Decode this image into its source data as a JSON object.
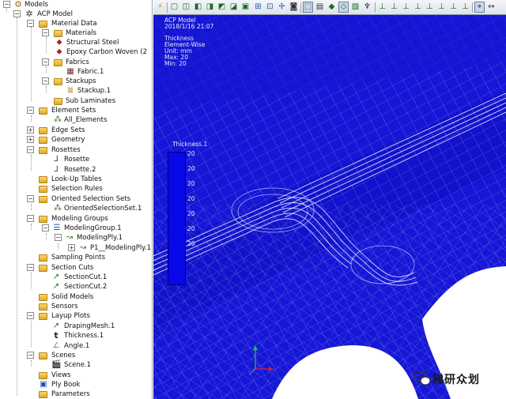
{
  "tree": {
    "root": "Models",
    "model": "ACP Model",
    "material_data": "Material Data",
    "materials": "Materials",
    "material_1": "Structural Steel",
    "material_2": "Epoxy Carbon Woven (2",
    "fabrics": "Fabrics",
    "fabric_1": "Fabric.1",
    "stackups": "Stackups",
    "stackup_1": "Stackup.1",
    "sub_laminates": "Sub Laminates",
    "element_sets": "Element Sets",
    "all_elements": "All_Elements",
    "edge_sets": "Edge Sets",
    "geometry": "Geometry",
    "rosettes": "Rosettes",
    "rosette_1": "Rosette",
    "rosette_2": "Rosette.2",
    "lookup_tables": "Look-Up Tables",
    "selection_rules": "Selection Rules",
    "oriented_selection_sets": "Oriented Selection Sets",
    "oss_1": "OrientedSelectionSet.1",
    "modeling_groups": "Modeling Groups",
    "modeling_group_1": "ModelingGroup.1",
    "modeling_ply_1": "ModelingPly.1",
    "production_ply": "P1__ModelingPly.1",
    "sampling_points": "Sampling Points",
    "section_cuts": "Section Cuts",
    "section_cut_1": "SectionCut.1",
    "section_cut_2": "SectionCut.2",
    "solid_models": "Solid Models",
    "sensors": "Sensors",
    "layup_plots": "Layup Plots",
    "draping_mesh": "DrapingMesh.1",
    "thickness_plot": "Thickness.1",
    "angle_plot": "Angle.1",
    "scenes": "Scenes",
    "scene_1": "Scene.1",
    "views": "Views",
    "ply_book": "Ply Book",
    "parameters": "Parameters"
  },
  "viewport": {
    "model_name": "ACP Model",
    "timestamp": "2018/1/16 21:07",
    "plot_name": "Thickness",
    "mode": "Element-Wise",
    "unit": "Unit: mm",
    "max": "Max: 20",
    "min": "Min: 20",
    "legend_title": "Thickness.1",
    "legend_ticks": [
      "20",
      "20",
      "20",
      "20",
      "20",
      "20",
      "20"
    ],
    "legend_color": "#0808e8",
    "mesh_color": "#1616d6"
  },
  "watermark": {
    "text": "梯研众划"
  }
}
